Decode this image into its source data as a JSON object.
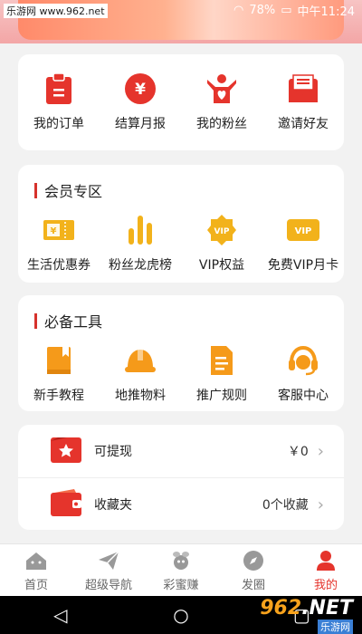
{
  "status": {
    "watermark": "乐游网 www.962.net",
    "battery": "78%",
    "time": "中午11:24"
  },
  "quick_actions": [
    {
      "label": "我的订单",
      "icon": "clipboard-icon"
    },
    {
      "label": "结算月报",
      "icon": "yen-coin-icon"
    },
    {
      "label": "我的粉丝",
      "icon": "fan-heart-icon"
    },
    {
      "label": "邀请好友",
      "icon": "envelope-icon"
    }
  ],
  "member": {
    "title": "会员专区",
    "items": [
      {
        "label": "生活优惠券",
        "icon": "coupon-icon"
      },
      {
        "label": "粉丝龙虎榜",
        "icon": "bar-chart-icon"
      },
      {
        "label": "VIP权益",
        "icon": "vip-badge-icon"
      },
      {
        "label": "免费VIP月卡",
        "icon": "vip-card-icon"
      }
    ]
  },
  "tools": {
    "title": "必备工具",
    "items": [
      {
        "label": "新手教程",
        "icon": "book-icon"
      },
      {
        "label": "地推物料",
        "icon": "helmet-icon"
      },
      {
        "label": "推广规则",
        "icon": "document-icon"
      },
      {
        "label": "客服中心",
        "icon": "headset-icon"
      }
    ]
  },
  "account": {
    "withdraw": {
      "label": "可提现",
      "value": "￥0"
    },
    "favorites": {
      "label": "收藏夹",
      "value": "0个收藏"
    }
  },
  "tabs": [
    {
      "label": "首页",
      "icon": "home-icon"
    },
    {
      "label": "超级导航",
      "icon": "paper-plane-icon"
    },
    {
      "label": "彩蜜赚",
      "icon": "bee-icon"
    },
    {
      "label": "发圈",
      "icon": "compass-icon"
    },
    {
      "label": "我的",
      "icon": "user-icon"
    }
  ],
  "watermark_br": {
    "text1": "962",
    "text2": ".NET",
    "text3": "乐游网"
  },
  "colors": {
    "accent": "#e5342c",
    "orange": "#f59a1a",
    "gold": "#f2b21b"
  }
}
